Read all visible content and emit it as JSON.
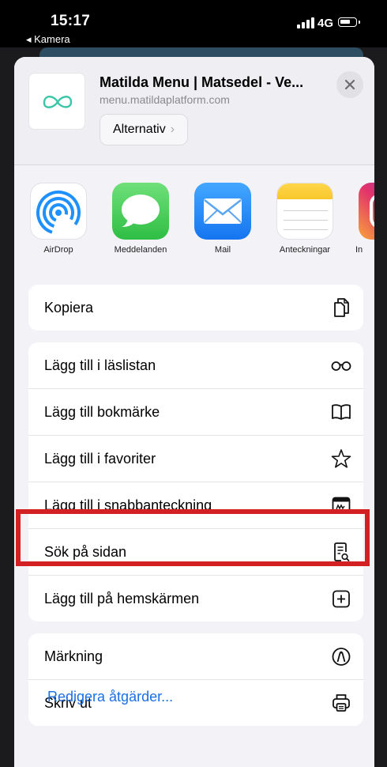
{
  "status_bar": {
    "time": "15:17",
    "back_app": "◂ Kamera",
    "network": "4G"
  },
  "header": {
    "site_title": "Matilda Menu | Matsedel - Ve...",
    "site_url": "menu.matildaplatform.com",
    "options_label": "Alternativ",
    "options_chevron": "›"
  },
  "apps": [
    {
      "label": "AirDrop",
      "icon": "airdrop-icon"
    },
    {
      "label": "Meddelanden",
      "icon": "messages-icon"
    },
    {
      "label": "Mail",
      "icon": "mail-icon"
    },
    {
      "label": "Anteckningar",
      "icon": "notes-icon"
    },
    {
      "label": "In",
      "icon": "instagram-icon"
    }
  ],
  "actions": {
    "copy": {
      "label": "Kopiera",
      "icon": "copy-icon"
    },
    "reading_list": {
      "label": "Lägg till i läslistan",
      "icon": "glasses-icon"
    },
    "bookmark": {
      "label": "Lägg till bokmärke",
      "icon": "book-icon"
    },
    "favorites": {
      "label": "Lägg till i favoriter",
      "icon": "star-icon"
    },
    "quick_note": {
      "label": "Lägg till i snabbanteckning",
      "icon": "quick-note-icon"
    },
    "find": {
      "label": "Sök på sidan",
      "icon": "find-in-page-icon"
    },
    "home_screen": {
      "label": "Lägg till på hemskärmen",
      "icon": "plus-square-icon"
    },
    "markup": {
      "label": "Märkning",
      "icon": "markup-icon"
    },
    "print": {
      "label": "Skriv ut",
      "icon": "printer-icon"
    }
  },
  "edit_actions_label": "Redigera åtgärder...",
  "colors": {
    "accent": "#1a6ee8",
    "highlight": "#d32023",
    "sheet_bg": "#f2f2f7"
  }
}
